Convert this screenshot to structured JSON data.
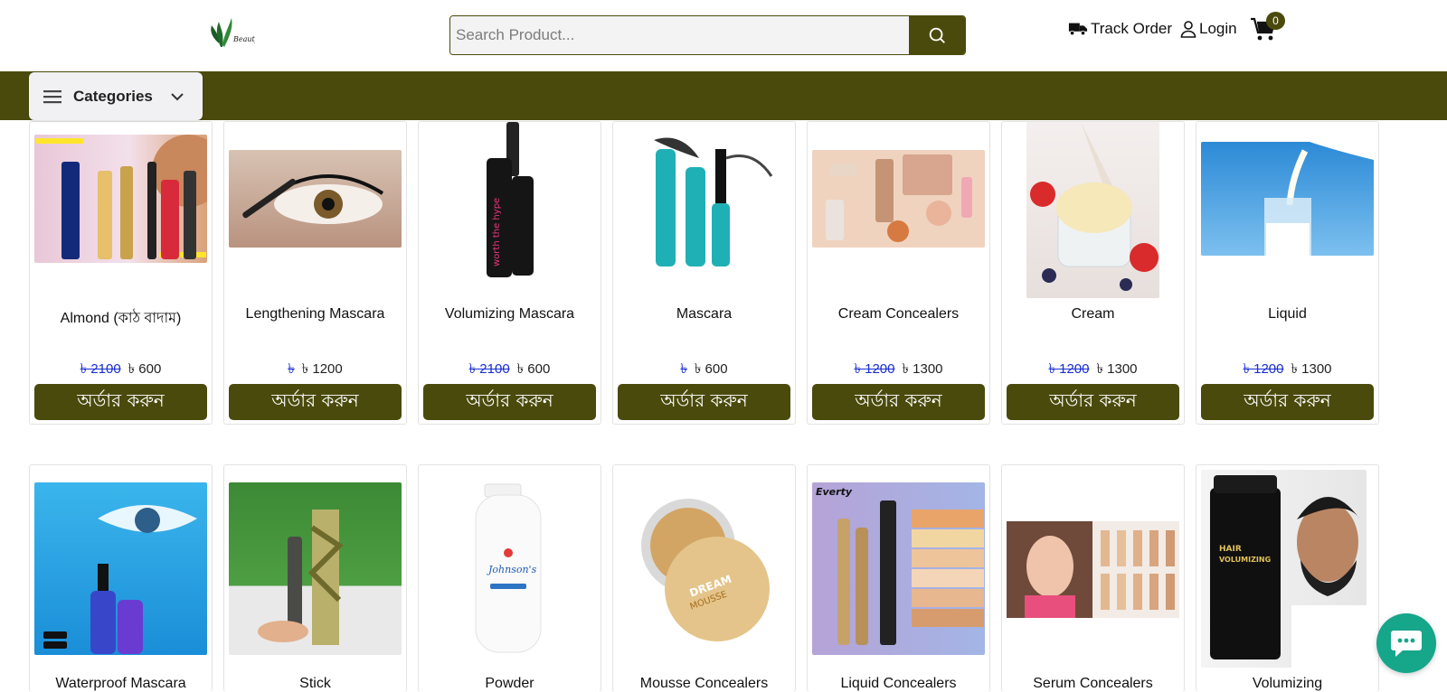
{
  "header": {
    "search": {
      "placeholder": "Search Product..."
    },
    "track_order": "Track Order",
    "login": "Login",
    "cart_count": "0"
  },
  "nav": {
    "categories_label": "Categories"
  },
  "colors": {
    "brand": "#4a4a0c",
    "strike_price": "#1a2fd0",
    "chat": "#16a68a"
  },
  "order_label": "অর্ডার করুন",
  "products_row1": [
    {
      "name": "Almond (কাঠ বাদাম)",
      "old_price": "৳ 2100",
      "price": "৳ 600"
    },
    {
      "name": "Lengthening Mascara",
      "old_price": "৳",
      "price": "৳ 1200"
    },
    {
      "name": "Volumizing Mascara",
      "old_price": "৳ 2100",
      "price": "৳ 600"
    },
    {
      "name": "Mascara",
      "old_price": "৳",
      "price": "৳ 600"
    },
    {
      "name": "Cream Concealers",
      "old_price": "৳ 1200",
      "price": "৳ 1300"
    },
    {
      "name": "Cream",
      "old_price": "৳ 1200",
      "price": "৳ 1300"
    },
    {
      "name": "Liquid",
      "old_price": "৳ 1200",
      "price": "৳ 1300"
    }
  ],
  "products_row2": [
    {
      "name": "Waterproof Mascara"
    },
    {
      "name": "Stick"
    },
    {
      "name": "Powder"
    },
    {
      "name": "Mousse Concealers"
    },
    {
      "name": "Liquid Concealers"
    },
    {
      "name": "Serum Concealers"
    },
    {
      "name": "Volumizing"
    }
  ]
}
